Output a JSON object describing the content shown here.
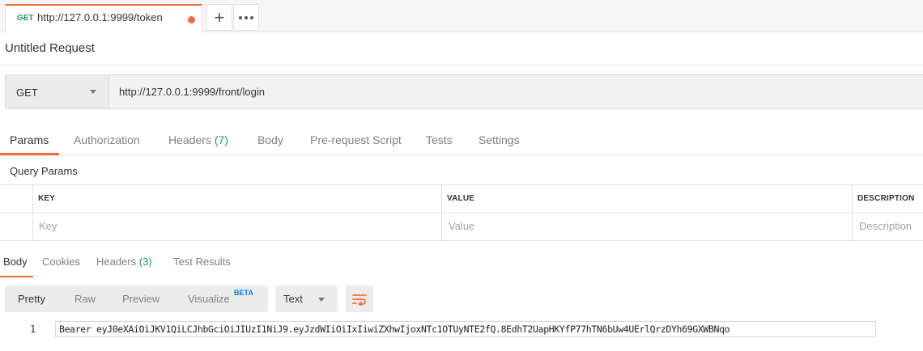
{
  "tabs": [
    {
      "method": "GET",
      "url": "http://127.0.0.1:9999/token",
      "modified": true
    }
  ],
  "request": {
    "title": "Untitled Request",
    "method": "GET",
    "url": "http://127.0.0.1:9999/front/login"
  },
  "request_tabs": {
    "params": "Params",
    "authorization": "Authorization",
    "headers": "Headers",
    "headers_count": "(7)",
    "body": "Body",
    "prerequest": "Pre-request Script",
    "tests": "Tests",
    "settings": "Settings",
    "active": "Params"
  },
  "query_params": {
    "label": "Query Params",
    "columns": {
      "key": "KEY",
      "value": "VALUE",
      "description": "DESCRIPTION"
    },
    "placeholders": {
      "key": "Key",
      "value": "Value",
      "description": "Description"
    }
  },
  "response_tabs": {
    "body": "Body",
    "cookies": "Cookies",
    "headers": "Headers",
    "headers_count": "(3)",
    "test_results": "Test Results",
    "active": "Body"
  },
  "response_view": {
    "modes": {
      "pretty": "Pretty",
      "raw": "Raw",
      "preview": "Preview",
      "visualize": "Visualize"
    },
    "beta_badge": "BETA",
    "active": "Pretty",
    "format": "Text"
  },
  "response_body": {
    "lines": [
      {
        "number": "1",
        "text": "Bearer eyJ0eXAiOiJKV1QiLCJhbGciOiJIUzI1NiJ9.eyJzdWIiOiIxIiwiZXhwIjoxNTc1OTUyNTE2fQ.8EdhT2UapHKYfP77hTN6bUw4UErlQrzDYh69GXWBNqo"
      }
    ]
  },
  "colors": {
    "accent": "#f26b3a",
    "method_get": "#1c9a60",
    "count": "#1c9a60",
    "beta": "#097bed"
  }
}
